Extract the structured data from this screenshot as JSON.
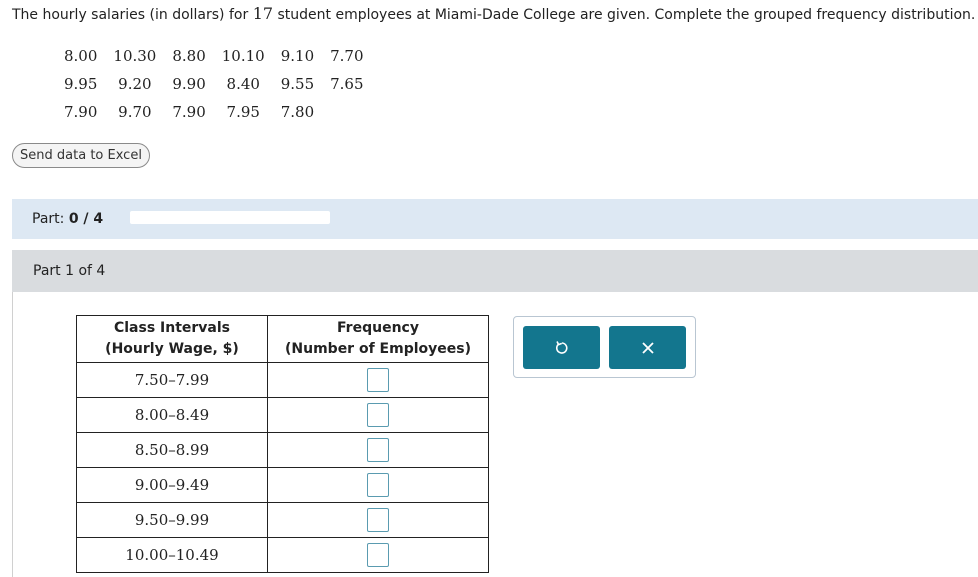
{
  "prompt": {
    "before": "The hourly salaries (in dollars) for ",
    "count": "17",
    "after": " student employees at Miami-Dade College are given. Complete the grouped frequency distribution."
  },
  "data_values": [
    [
      "8.00",
      "10.30",
      "8.80",
      "10.10",
      "9.10",
      "7.70"
    ],
    [
      "9.95",
      "9.20",
      "9.90",
      "8.40",
      "9.55",
      "7.65"
    ],
    [
      "7.90",
      "9.70",
      "7.90",
      "7.95",
      "7.80"
    ]
  ],
  "excel_button": "Send data to Excel",
  "part_progress": {
    "label": "Part: ",
    "value": "0 / 4",
    "fraction": 0
  },
  "part_header": "Part 1 of 4",
  "table": {
    "col1_line1": "Class Intervals",
    "col1_line2": "(Hourly Wage, $)",
    "col2_line1": "Frequency",
    "col2_line2": "(Number of Employees)",
    "rows": [
      "7.50–7.99",
      "8.00–8.49",
      "8.50–8.99",
      "9.00–9.49",
      "9.50–9.99",
      "10.00–10.49"
    ]
  },
  "tools": {
    "undo_icon": "undo-icon",
    "clear_icon": "close-icon"
  },
  "colors": {
    "accent": "#13768e",
    "part_bar": "#dde8f3",
    "part_header_bar": "#d9dcdf"
  }
}
